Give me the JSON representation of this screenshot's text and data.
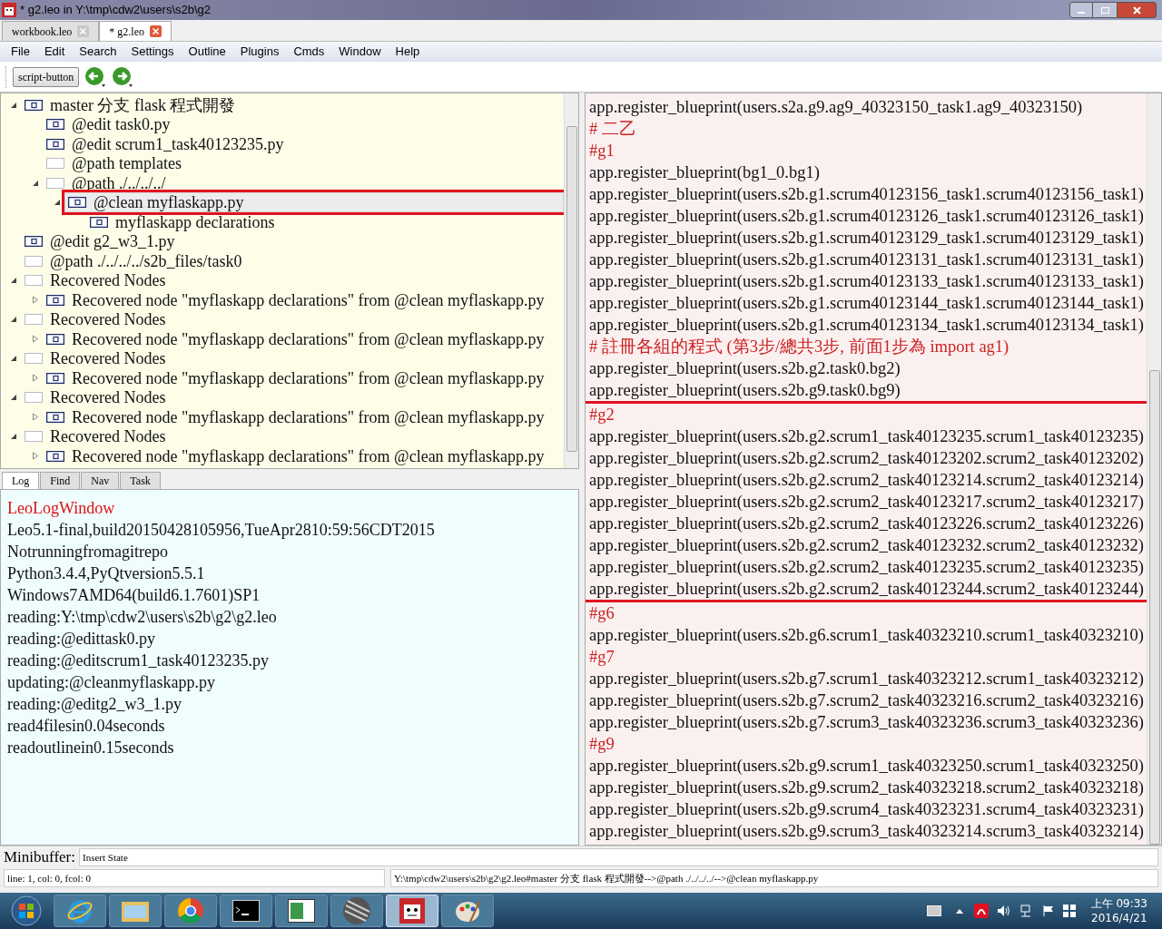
{
  "window": {
    "title": "* g2.leo in Y:\\tmp\\cdw2\\users\\s2b\\g2"
  },
  "tabs": [
    {
      "label": "workbook.leo",
      "selected": false
    },
    {
      "label": "* g2.leo",
      "selected": true
    }
  ],
  "menu": [
    "File",
    "Edit",
    "Search",
    "Settings",
    "Outline",
    "Plugins",
    "Cmds",
    "Window",
    "Help"
  ],
  "toolbar": {
    "script_button": "script-button"
  },
  "tree": [
    {
      "label": "master 分支 flask 程式開發",
      "kind": "content",
      "expanded": true,
      "selected": false,
      "highlighted": false,
      "children": [
        {
          "label": "@edit task0.py",
          "kind": "content",
          "selected": false,
          "highlighted": false
        },
        {
          "label": "@edit scrum1_task40123235.py",
          "kind": "content",
          "selected": false,
          "highlighted": false
        },
        {
          "label": "@path templates",
          "kind": "empty",
          "selected": false,
          "highlighted": false
        },
        {
          "label": "@path ./../../../",
          "kind": "empty",
          "expanded": true,
          "selected": false,
          "highlighted": false,
          "children": [
            {
              "label": "@clean myflaskapp.py",
              "kind": "content",
              "expanded": true,
              "selected": true,
              "highlighted": true,
              "children": [
                {
                  "label": "myflaskapp declarations",
                  "kind": "content",
                  "selected": false,
                  "highlighted": false
                }
              ]
            }
          ]
        }
      ]
    },
    {
      "label": "@edit g2_w3_1.py",
      "kind": "content",
      "selected": false,
      "highlighted": false
    },
    {
      "label": "@path ./../../../s2b_files/task0",
      "kind": "empty",
      "selected": false,
      "highlighted": false
    },
    {
      "label": "Recovered Nodes",
      "kind": "empty",
      "expanded": true,
      "selected": false,
      "highlighted": false,
      "children": [
        {
          "label": "Recovered node \"myflaskapp declarations\" from @clean myflaskapp.py",
          "kind": "content",
          "expanded": false,
          "selected": false,
          "highlighted": false
        }
      ]
    },
    {
      "label": "Recovered Nodes",
      "kind": "empty",
      "expanded": true,
      "selected": false,
      "highlighted": false,
      "children": [
        {
          "label": "Recovered node \"myflaskapp declarations\" from @clean myflaskapp.py",
          "kind": "content",
          "expanded": false,
          "selected": false,
          "highlighted": false
        }
      ]
    },
    {
      "label": "Recovered Nodes",
      "kind": "empty",
      "expanded": true,
      "selected": false,
      "highlighted": false,
      "children": [
        {
          "label": "Recovered node \"myflaskapp declarations\" from @clean myflaskapp.py",
          "kind": "content",
          "expanded": false,
          "selected": false,
          "highlighted": false
        }
      ]
    },
    {
      "label": "Recovered Nodes",
      "kind": "empty",
      "expanded": true,
      "selected": false,
      "highlighted": false,
      "children": [
        {
          "label": "Recovered node \"myflaskapp declarations\" from @clean myflaskapp.py",
          "kind": "content",
          "expanded": false,
          "selected": false,
          "highlighted": false
        }
      ]
    },
    {
      "label": "Recovered Nodes",
      "kind": "empty",
      "expanded": true,
      "selected": false,
      "highlighted": false,
      "children": [
        {
          "label": "Recovered node \"myflaskapp declarations\" from @clean myflaskapp.py",
          "kind": "content",
          "expanded": false,
          "selected": false,
          "highlighted": false
        }
      ]
    }
  ],
  "log_tabs": [
    {
      "label": "Log",
      "selected": true
    },
    {
      "label": "Find",
      "selected": false
    },
    {
      "label": "Nav",
      "selected": false
    },
    {
      "label": "Task",
      "selected": false
    }
  ],
  "log_lines": [
    {
      "kind": "title",
      "text": "LeoLogWindow"
    },
    {
      "kind": "info",
      "text": "Leo5.1-final,build20150428105956,TueApr2810:59:56CDT2015"
    },
    {
      "kind": "info",
      "text": "Notrunningfromagitrepo"
    },
    {
      "kind": "info",
      "text": "Python3.4.4,PyQtversion5.5.1"
    },
    {
      "kind": "info",
      "text": "Windows7AMD64(build6.1.7601)SP1"
    },
    {
      "kind": "info",
      "text": "reading:Y:\\tmp\\cdw2\\users\\s2b\\g2\\g2.leo"
    },
    {
      "kind": "info",
      "text": "reading:@edittask0.py"
    },
    {
      "kind": "info",
      "text": "reading:@editscrum1_task40123235.py"
    },
    {
      "kind": "info",
      "text": "updating:@cleanmyflaskapp.py"
    },
    {
      "kind": "info",
      "text": "reading:@editg2_w3_1.py"
    },
    {
      "kind": "info",
      "text": "read4filesin0.04seconds"
    },
    {
      "kind": "info",
      "text": "readoutlinein0.15seconds"
    }
  ],
  "body_sections": [
    {
      "highlighted": false,
      "lines": [
        {
          "kind": "code",
          "text": "app.register_blueprint(users.s2a.g9.ag9_40323150_task1.ag9_40323150)"
        },
        {
          "kind": "comment",
          "text": "# 二乙"
        },
        {
          "kind": "comment",
          "text": "#g1"
        },
        {
          "kind": "code",
          "text": "app.register_blueprint(bg1_0.bg1)"
        },
        {
          "kind": "code",
          "text": "app.register_blueprint(users.s2b.g1.scrum40123156_task1.scrum40123156_task1)"
        },
        {
          "kind": "code",
          "text": "app.register_blueprint(users.s2b.g1.scrum40123126_task1.scrum40123126_task1)"
        },
        {
          "kind": "code",
          "text": "app.register_blueprint(users.s2b.g1.scrum40123129_task1.scrum40123129_task1)"
        },
        {
          "kind": "code",
          "text": "app.register_blueprint(users.s2b.g1.scrum40123131_task1.scrum40123131_task1)"
        },
        {
          "kind": "code",
          "text": "app.register_blueprint(users.s2b.g1.scrum40123133_task1.scrum40123133_task1)"
        },
        {
          "kind": "code",
          "text": "app.register_blueprint(users.s2b.g1.scrum40123144_task1.scrum40123144_task1)"
        },
        {
          "kind": "code",
          "text": "app.register_blueprint(users.s2b.g1.scrum40123134_task1.scrum40123134_task1)"
        },
        {
          "kind": "comment",
          "text": "# 註冊各組的程式 (第3步/總共3步, 前面1步為 import ag1)"
        },
        {
          "kind": "code",
          "text": "app.register_blueprint(users.s2b.g2.task0.bg2)"
        },
        {
          "kind": "code",
          "text": "app.register_blueprint(users.s2b.g9.task0.bg9)"
        }
      ]
    },
    {
      "highlighted": true,
      "lines": [
        {
          "kind": "comment",
          "text": "#g2"
        },
        {
          "kind": "code",
          "text": "app.register_blueprint(users.s2b.g2.scrum1_task40123235.scrum1_task40123235)"
        },
        {
          "kind": "code",
          "text": "app.register_blueprint(users.s2b.g2.scrum2_task40123202.scrum2_task40123202)"
        },
        {
          "kind": "code",
          "text": "app.register_blueprint(users.s2b.g2.scrum2_task40123214.scrum2_task40123214)"
        },
        {
          "kind": "code",
          "text": "app.register_blueprint(users.s2b.g2.scrum2_task40123217.scrum2_task40123217)"
        },
        {
          "kind": "code",
          "text": "app.register_blueprint(users.s2b.g2.scrum2_task40123226.scrum2_task40123226)"
        },
        {
          "kind": "code",
          "text": "app.register_blueprint(users.s2b.g2.scrum2_task40123232.scrum2_task40123232)"
        },
        {
          "kind": "code",
          "text": "app.register_blueprint(users.s2b.g2.scrum2_task40123235.scrum2_task40123235)"
        },
        {
          "kind": "code",
          "text": "app.register_blueprint(users.s2b.g2.scrum2_task40123244.scrum2_task40123244)"
        }
      ]
    },
    {
      "highlighted": false,
      "lines": [
        {
          "kind": "comment",
          "text": "#g6"
        },
        {
          "kind": "code",
          "text": "app.register_blueprint(users.s2b.g6.scrum1_task40323210.scrum1_task40323210)"
        },
        {
          "kind": "comment",
          "text": "#g7"
        },
        {
          "kind": "code",
          "text": "app.register_blueprint(users.s2b.g7.scrum1_task40323212.scrum1_task40323212)"
        },
        {
          "kind": "code",
          "text": "app.register_blueprint(users.s2b.g7.scrum2_task40323216.scrum2_task40323216)"
        },
        {
          "kind": "code",
          "text": "app.register_blueprint(users.s2b.g7.scrum3_task40323236.scrum3_task40323236)"
        },
        {
          "kind": "comment",
          "text": "#g9"
        },
        {
          "kind": "code",
          "text": "app.register_blueprint(users.s2b.g9.scrum1_task40323250.scrum1_task40323250)"
        },
        {
          "kind": "code",
          "text": "app.register_blueprint(users.s2b.g9.scrum2_task40323218.scrum2_task40323218)"
        },
        {
          "kind": "code",
          "text": "app.register_blueprint(users.s2b.g9.scrum4_task40323231.scrum4_task40323231)"
        },
        {
          "kind": "code",
          "text": "app.register_blueprint(users.s2b.g9.scrum3_task40323214.scrum3_task40323214)"
        }
      ]
    }
  ],
  "minibuffer": {
    "label": "Minibuffer:",
    "value": "Insert State"
  },
  "status_bar": {
    "position": "line: 1, col: 0, fcol: 0",
    "path": "Y:\\tmp\\cdw2\\users\\s2b\\g2\\g2.leo#master 分支 flask 程式開發-->@path ./../../../-->@clean myflaskapp.py"
  },
  "taskbar": {
    "apps": [
      {
        "kind": "ie",
        "active": false
      },
      {
        "kind": "folder",
        "active": false
      },
      {
        "kind": "chrome",
        "active": false
      },
      {
        "kind": "terminal",
        "active": false
      },
      {
        "kind": "window",
        "active": false
      },
      {
        "kind": "sphere",
        "active": false
      },
      {
        "kind": "leo",
        "active": true
      },
      {
        "kind": "paint",
        "active": false
      }
    ],
    "time": "上午 09:33",
    "date": "2016/4/21"
  }
}
